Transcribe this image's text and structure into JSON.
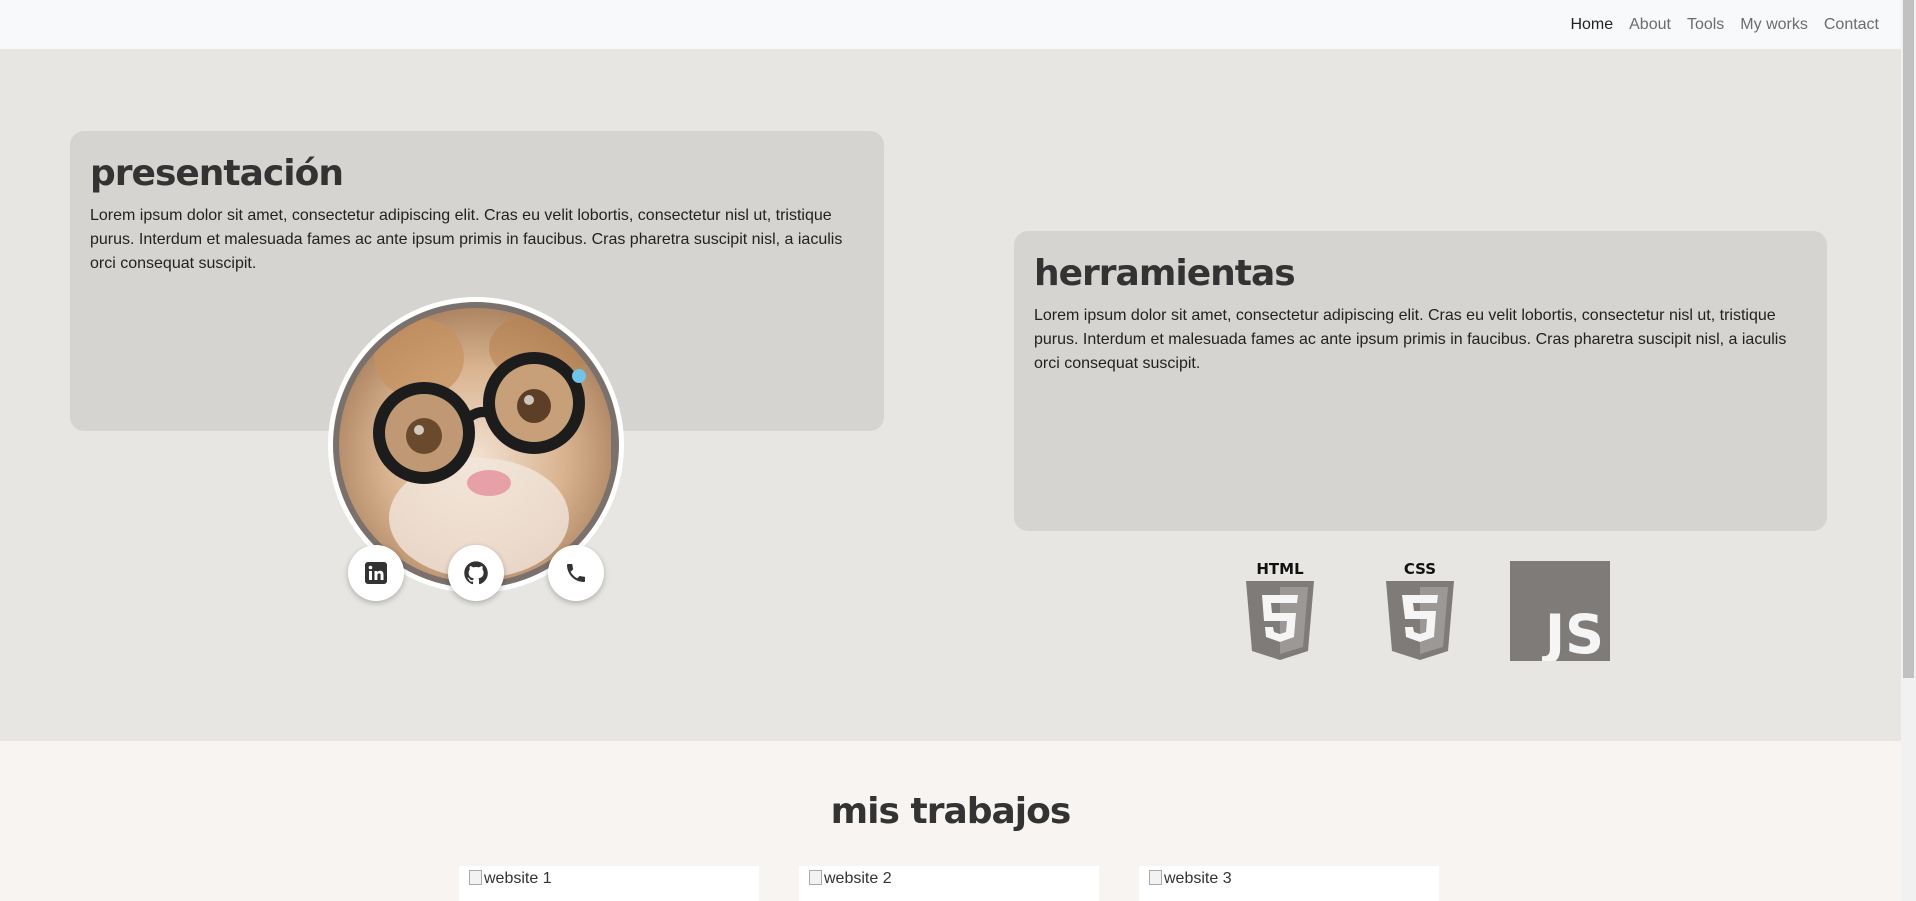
{
  "nav": {
    "items": [
      {
        "label": "Home",
        "active": true
      },
      {
        "label": "About",
        "active": false
      },
      {
        "label": "Tools",
        "active": false
      },
      {
        "label": "My works",
        "active": false
      },
      {
        "label": "Contact",
        "active": false
      }
    ]
  },
  "presentation": {
    "title": "presentación",
    "text": "Lorem ipsum dolor sit amet, consectetur adipiscing elit. Cras eu velit lobortis, consectetur nisl ut, tristique purus. Interdum et malesuada fames ac ante ipsum primis in faucibus. Cras pharetra suscipit nisl, a iaculis orci consequat suscipit."
  },
  "tools": {
    "title": "herramientas",
    "text": "Lorem ipsum dolor sit amet, consectetur adipiscing elit. Cras eu velit lobortis, consectetur nisl ut, tristique purus. Interdum et malesuada fames ac ante ipsum primis in faucibus. Cras pharetra suscipit nisl, a iaculis orci consequat suscipit.",
    "tech": [
      {
        "icon": "html5-icon",
        "label": "HTML"
      },
      {
        "icon": "css3-icon",
        "label": "CSS"
      },
      {
        "icon": "javascript-icon",
        "label": "JS"
      }
    ]
  },
  "social": [
    {
      "icon": "linkedin-icon"
    },
    {
      "icon": "github-icon"
    },
    {
      "icon": "phone-icon"
    }
  ],
  "works": {
    "title": "mis trabajos",
    "items": [
      {
        "alt": "website 1"
      },
      {
        "alt": "website 2"
      },
      {
        "alt": "website 3"
      }
    ]
  },
  "colors": {
    "hero_bg": "#e7e6e3",
    "card_bg": "#d5d4d0",
    "icon_grey": "#7f7b78",
    "heading": "#333333"
  }
}
